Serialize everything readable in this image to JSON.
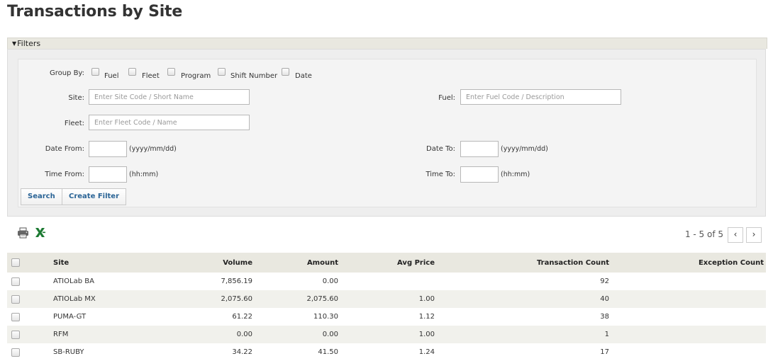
{
  "page": {
    "title": "Transactions by Site"
  },
  "filters": {
    "toggle_label": "Filters",
    "group_by": {
      "label": "Group By:",
      "options": [
        {
          "label": "Fuel",
          "checked": false
        },
        {
          "label": "Fleet",
          "checked": false
        },
        {
          "label": "Program",
          "checked": false
        },
        {
          "label": "Shift Number",
          "checked": false
        },
        {
          "label": "Date",
          "checked": false
        }
      ]
    },
    "site": {
      "label": "Site:",
      "value": "",
      "placeholder": "Enter Site Code / Short Name"
    },
    "fuel": {
      "label": "Fuel:",
      "value": "",
      "placeholder": "Enter Fuel Code / Description"
    },
    "fleet": {
      "label": "Fleet:",
      "value": "",
      "placeholder": "Enter Fleet Code / Name"
    },
    "date_from": {
      "label": "Date From:",
      "value": "",
      "hint": "(yyyy/mm/dd)"
    },
    "date_to": {
      "label": "Date To:",
      "value": "",
      "hint": "(yyyy/mm/dd)"
    },
    "time_from": {
      "label": "Time From:",
      "value": "",
      "hint": "(hh:mm)"
    },
    "time_to": {
      "label": "Time To:",
      "value": "",
      "hint": "(hh:mm)"
    },
    "search_label": "Search",
    "create_filter_label": "Create Filter"
  },
  "toolbar": {
    "print_icon": "printer-icon",
    "excel_icon": "excel-export-icon"
  },
  "pager": {
    "text": "1 - 5 of 5",
    "prev": "‹",
    "next": "›"
  },
  "table": {
    "columns": [
      "Site",
      "Volume",
      "Amount",
      "Avg Price",
      "Transaction Count",
      "Exception Count"
    ],
    "rows": [
      {
        "site": "ATIOLab BA",
        "volume": "7,856.19",
        "amount": "0.00",
        "avg_price": "",
        "transaction_count": "92",
        "exception_count": ""
      },
      {
        "site": "ATIOLab MX",
        "volume": "2,075.60",
        "amount": "2,075.60",
        "avg_price": "1.00",
        "transaction_count": "40",
        "exception_count": ""
      },
      {
        "site": "PUMA-GT",
        "volume": "61.22",
        "amount": "110.30",
        "avg_price": "1.12",
        "transaction_count": "38",
        "exception_count": ""
      },
      {
        "site": "RFM",
        "volume": "0.00",
        "amount": "0.00",
        "avg_price": "1.00",
        "transaction_count": "1",
        "exception_count": ""
      },
      {
        "site": "SB-RUBY",
        "volume": "34.22",
        "amount": "41.50",
        "avg_price": "1.24",
        "transaction_count": "17",
        "exception_count": ""
      }
    ]
  },
  "colors": {
    "header_bg": "#e9e8e0",
    "link": "#2a6496",
    "excel_green": "#1e7b34"
  }
}
